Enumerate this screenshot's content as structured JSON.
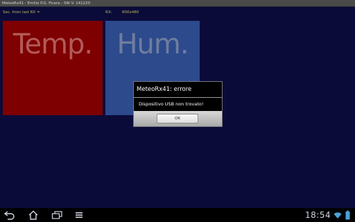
{
  "window": {
    "title": "MeteoRx41 - Emilio P.G. Ficara - SW V. 141220"
  },
  "status": {
    "sec_label": "Sec. from last RX =",
    "rx_label": "RX:",
    "resolution": "800x480"
  },
  "tiles": {
    "temp_label": "Temp.",
    "hum_label": "Hum."
  },
  "dialog": {
    "title": "MeteoRx41: errore",
    "message": "Dispositivo USB non trovato!",
    "ok_label": "OK"
  },
  "navbar": {
    "icons": [
      "back-icon",
      "home-icon",
      "recent-apps-icon",
      "menu-icon"
    ],
    "clock": "18:54",
    "status_icons": [
      "wifi-icon",
      "battery-icon"
    ]
  },
  "colors": {
    "background": "#0b0b3a",
    "temp_tile": "#7e0000",
    "hum_tile": "#2c4a8c",
    "status_text": "#b9b75a"
  }
}
